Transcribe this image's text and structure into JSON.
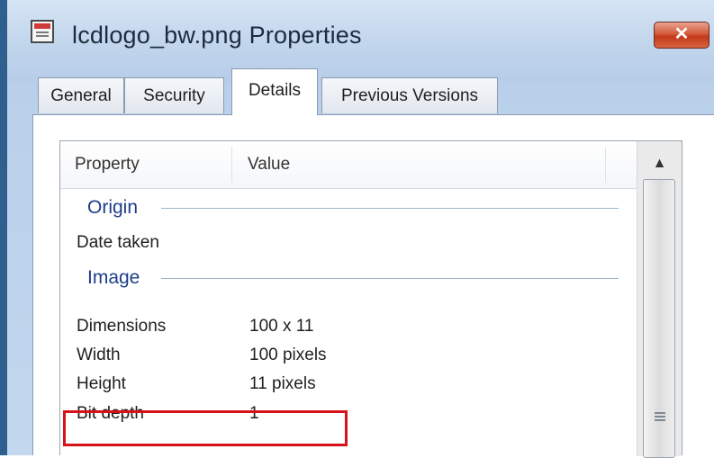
{
  "window": {
    "title": "lcdlogo_bw.png Properties",
    "close_icon": "close-icon",
    "file_icon": "image-file-icon"
  },
  "tabs": [
    {
      "label": "General",
      "active": false
    },
    {
      "label": "Security",
      "active": false
    },
    {
      "label": "Details",
      "active": true
    },
    {
      "label": "Previous Versions",
      "active": false
    }
  ],
  "list": {
    "columns": [
      "Property",
      "Value"
    ],
    "groups": [
      {
        "label": "Origin",
        "rows": [
          {
            "property": "Date taken",
            "value": ""
          }
        ]
      },
      {
        "label": "Image",
        "rows": [
          {
            "property": "Dimensions",
            "value": "100 x 11"
          },
          {
            "property": "Width",
            "value": "100 pixels"
          },
          {
            "property": "Height",
            "value": "11 pixels"
          },
          {
            "property": "Bit depth",
            "value": "1"
          }
        ]
      }
    ]
  },
  "colors": {
    "highlight_border": "#d6121b",
    "group_label": "#1e3d8a",
    "close_button": "#c2391b"
  }
}
